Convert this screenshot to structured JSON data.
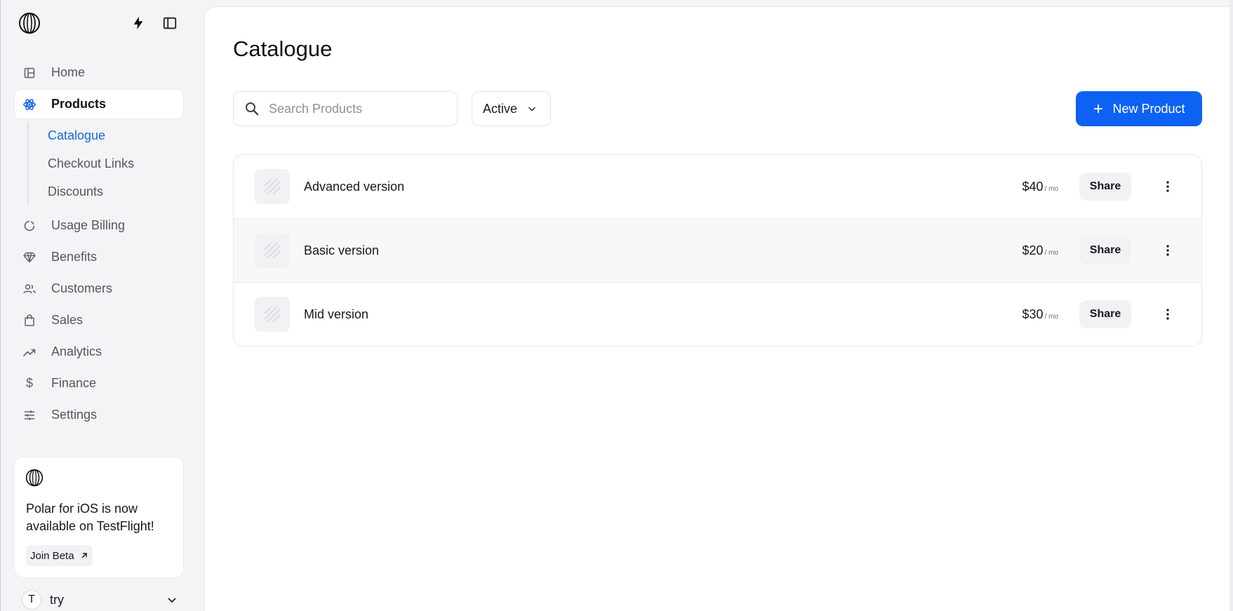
{
  "sidebar": {
    "nav": [
      {
        "label": "Home",
        "icon": "home-icon"
      },
      {
        "label": "Products",
        "icon": "products-icon",
        "active": true
      },
      {
        "label": "Usage Billing",
        "icon": "usage-billing-icon"
      },
      {
        "label": "Benefits",
        "icon": "diamond-icon"
      },
      {
        "label": "Customers",
        "icon": "customers-icon"
      },
      {
        "label": "Sales",
        "icon": "shopping-bag-icon"
      },
      {
        "label": "Analytics",
        "icon": "trending-up-icon"
      },
      {
        "label": "Finance",
        "icon": "dollar-icon"
      },
      {
        "label": "Settings",
        "icon": "sliders-icon"
      }
    ],
    "subnav": [
      {
        "label": "Catalogue",
        "active": true
      },
      {
        "label": "Checkout Links"
      },
      {
        "label": "Discounts"
      }
    ],
    "promo": {
      "text": "Polar for iOS is now available on TestFlight!",
      "button": "Join Beta"
    },
    "account": {
      "initial": "T",
      "name": "try"
    }
  },
  "main": {
    "title": "Catalogue",
    "search": {
      "placeholder": "Search Products",
      "value": ""
    },
    "status_filter": "Active",
    "new_button": "New Product",
    "products": [
      {
        "name": "Advanced version",
        "price": "$40",
        "period": "/ mo",
        "share": "Share"
      },
      {
        "name": "Basic version",
        "price": "$20",
        "period": "/ mo",
        "share": "Share"
      },
      {
        "name": "Mid version",
        "price": "$30",
        "period": "/ mo",
        "share": "Share"
      }
    ]
  },
  "colors": {
    "accent": "#0d62f4",
    "active_sub": "#1a66e0",
    "sidebar_bg": "#f3f4f6"
  }
}
